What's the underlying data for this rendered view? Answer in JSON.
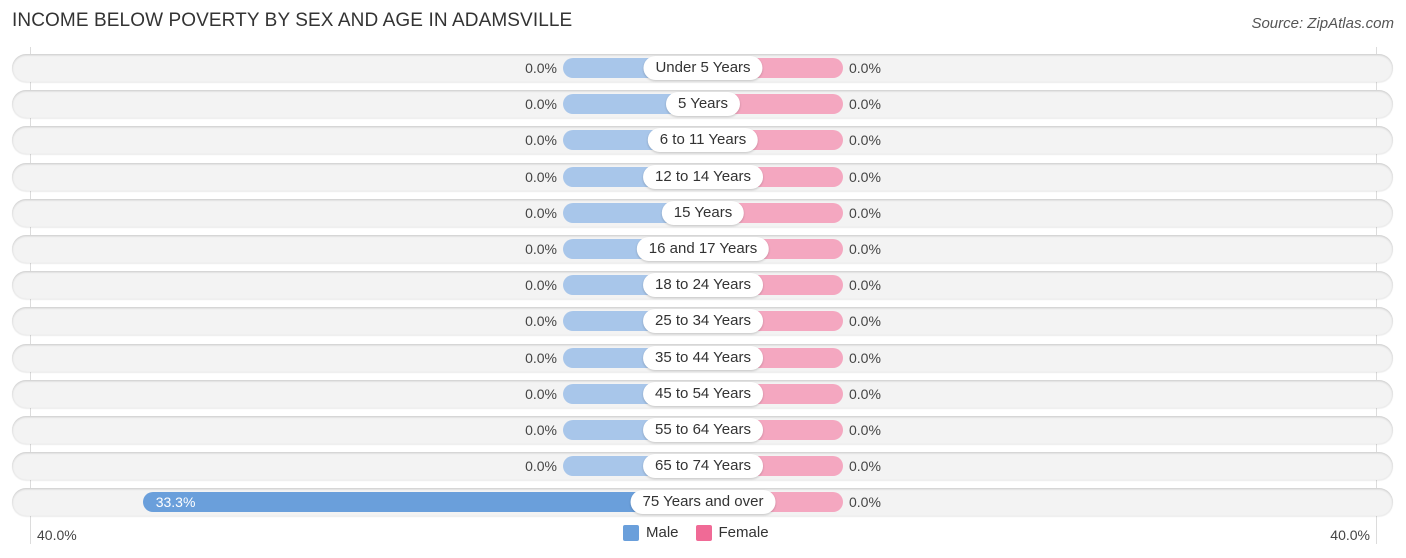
{
  "header": {
    "title": "INCOME BELOW POVERTY BY SEX AND AGE IN ADAMSVILLE",
    "source": "Source: ZipAtlas.com"
  },
  "colors": {
    "male": "#6a9fdb",
    "male_light": "#a8c6ea",
    "female": "#f06a96",
    "female_light": "#f4a7c0",
    "row_bg": "#f3f3f3"
  },
  "chart_data": {
    "type": "bar",
    "orientation": "horizontal-diverging",
    "title": "INCOME BELOW POVERTY BY SEX AND AGE IN ADAMSVILLE",
    "source": "Source: ZipAtlas.com",
    "categories": [
      "Under 5 Years",
      "5 Years",
      "6 to 11 Years",
      "12 to 14 Years",
      "15 Years",
      "16 and 17 Years",
      "18 to 24 Years",
      "25 to 34 Years",
      "35 to 44 Years",
      "45 to 54 Years",
      "55 to 64 Years",
      "65 to 74 Years",
      "75 Years and over"
    ],
    "series": [
      {
        "name": "Male",
        "values": [
          0.0,
          0.0,
          0.0,
          0.0,
          0.0,
          0.0,
          0.0,
          0.0,
          0.0,
          0.0,
          0.0,
          0.0,
          33.3
        ],
        "labels": [
          "0.0%",
          "0.0%",
          "0.0%",
          "0.0%",
          "0.0%",
          "0.0%",
          "0.0%",
          "0.0%",
          "0.0%",
          "0.0%",
          "0.0%",
          "0.0%",
          "33.3%"
        ]
      },
      {
        "name": "Female",
        "values": [
          0.0,
          0.0,
          0.0,
          0.0,
          0.0,
          0.0,
          0.0,
          0.0,
          0.0,
          0.0,
          0.0,
          0.0,
          0.0
        ],
        "labels": [
          "0.0%",
          "0.0%",
          "0.0%",
          "0.0%",
          "0.0%",
          "0.0%",
          "0.0%",
          "0.0%",
          "0.0%",
          "0.0%",
          "0.0%",
          "0.0%",
          "0.0%"
        ]
      }
    ],
    "axis": {
      "min_label": "40.0%",
      "max_label": "40.0%",
      "range": [
        -40,
        40
      ],
      "unit": "%"
    },
    "legend": {
      "position": "bottom-center",
      "entries": [
        "Male",
        "Female"
      ]
    },
    "grid": false
  }
}
